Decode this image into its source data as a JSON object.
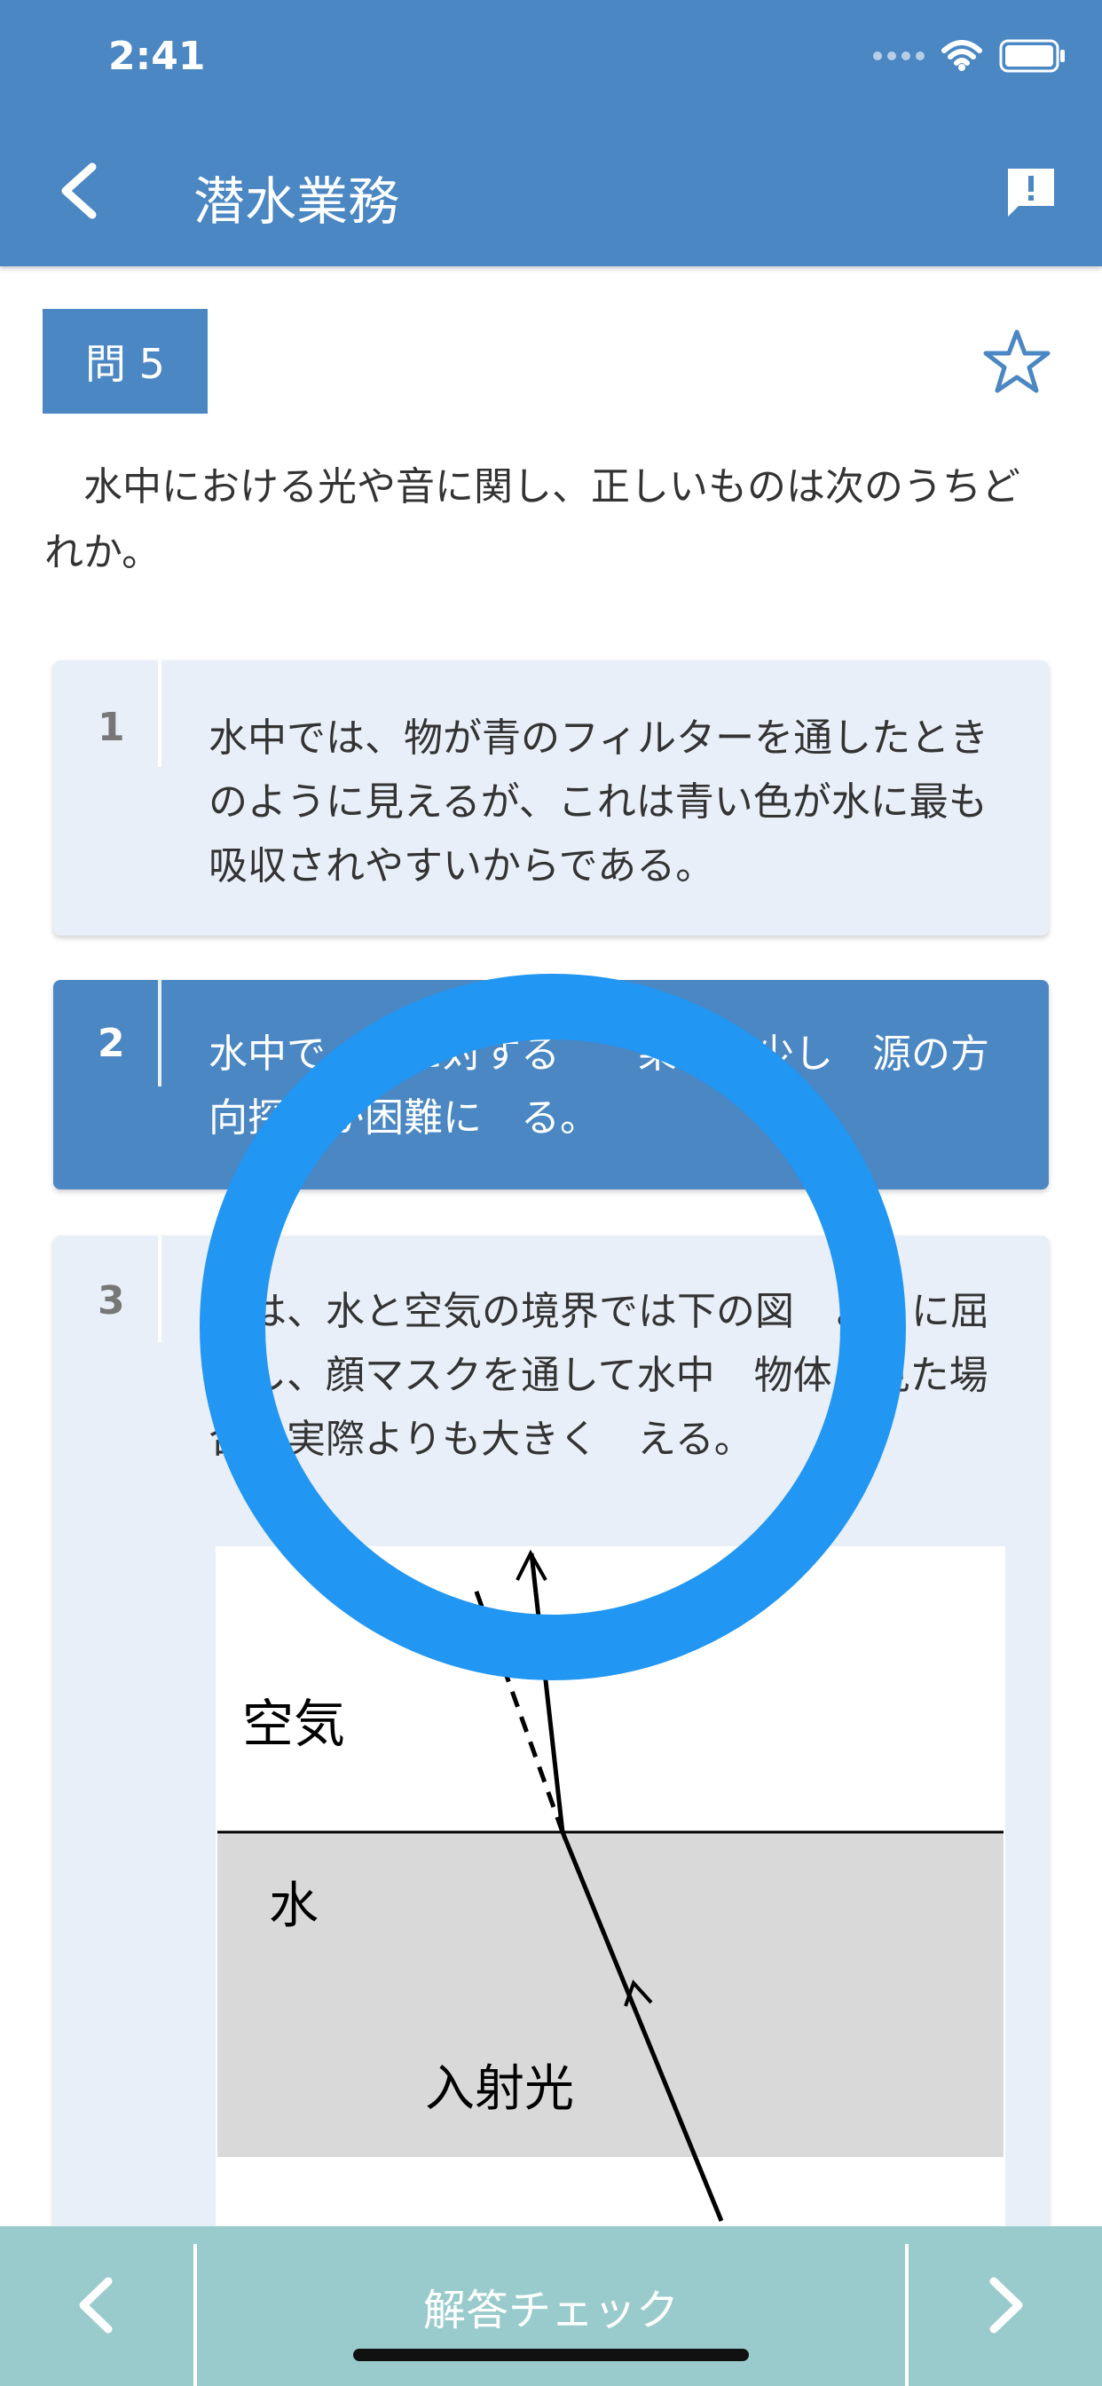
{
  "status_bar": {
    "time": "2:41"
  },
  "header": {
    "title": "潜水業務"
  },
  "question": {
    "badge": "問 5",
    "text": "　水中における光や音に関し、正しいものは次のうちどれか。"
  },
  "choices": [
    {
      "number": "1",
      "text": "水中では、物が青のフィルターを通したときのように見えるが、これは青い色が水に最も吸収されやすいからである。",
      "selected": false
    },
    {
      "number": "2",
      "text": "水中で　音に対する　　果が減少し　源の方向探知が困難に　る。",
      "selected": true
    },
    {
      "number": "3",
      "text": "　は、水と空気の境界では下の図　ように屈折し、顔マスクを通して水中　物体　見た場合、実際よりも大きく　える。",
      "selected": false
    }
  ],
  "figure": {
    "air_label": "空気",
    "water_label": "水",
    "incident_label": "入射光"
  },
  "footer": {
    "check_label": "解答チェック"
  },
  "colors": {
    "primary": "#4a87c3",
    "footer": "#9acbcc",
    "ring": "#2196f3",
    "choice_bg": "#e9eff8"
  }
}
